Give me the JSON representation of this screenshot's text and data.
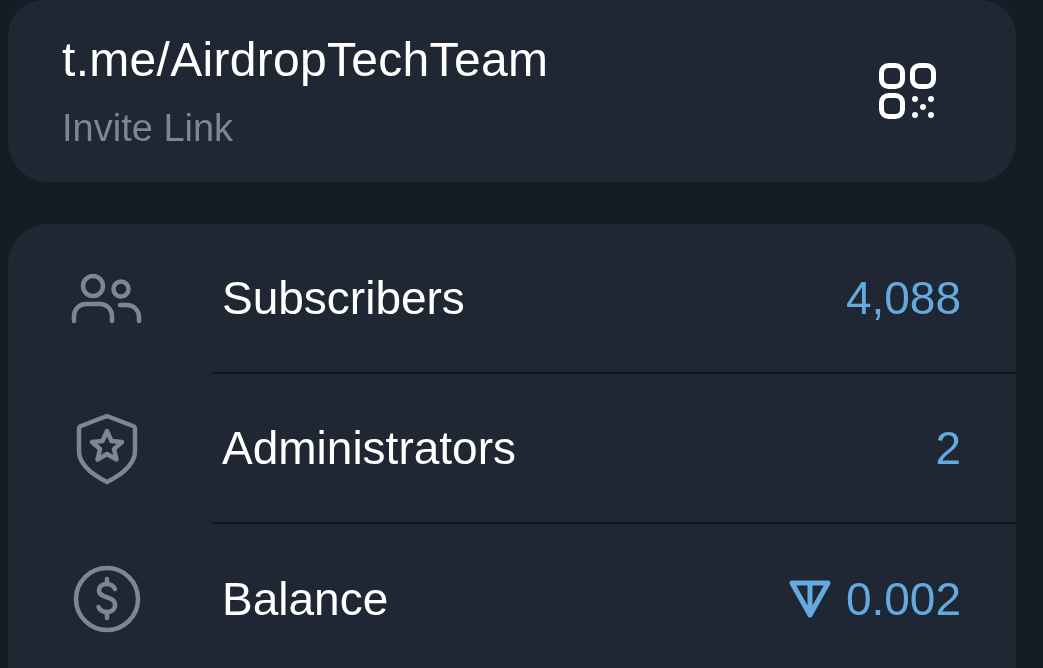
{
  "invite": {
    "link": "t.me/AirdropTechTeam",
    "label": "Invite Link"
  },
  "stats": [
    {
      "kind": "users",
      "label": "Subscribers",
      "value": "4,088"
    },
    {
      "kind": "admins",
      "label": "Administrators",
      "value": "2"
    },
    {
      "kind": "balance",
      "label": "Balance",
      "value": "0.002"
    }
  ]
}
